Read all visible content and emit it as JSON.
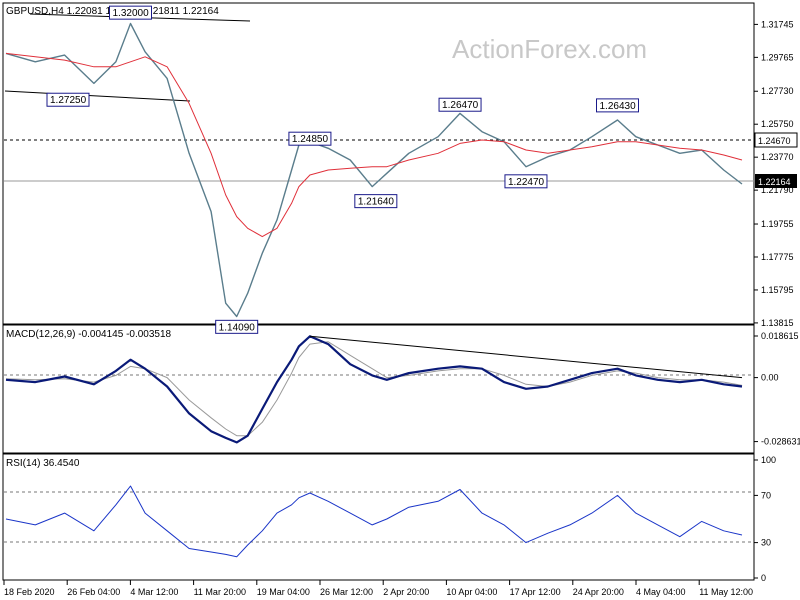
{
  "colors": {
    "price": "#5a7d8c",
    "ema": "#e0303a",
    "macd": "#0a1a78",
    "signal": "#9a9a9a",
    "rsi": "#1a35c8",
    "box_border": "#1a1a8a"
  },
  "watermark": "ActionForex.com",
  "price_panel": {
    "header": "GBPUSD,H4  1.22081 1.22178 1.21811 1.22164",
    "ylim": [
      1.1387,
      1.3285
    ],
    "ticks": [
      "1.31745",
      "1.29765",
      "1.27730",
      "1.25750",
      "1.23770",
      "1.21790",
      "1.19755",
      "1.17775",
      "1.15795",
      "1.13815"
    ],
    "current_price": "1.22164",
    "level_line": "1.24670",
    "annotations": [
      {
        "text": "1.32000",
        "x": 34,
        "y": 1.32
      },
      {
        "text": "1.27250",
        "x": 14,
        "y": 1.2725
      },
      {
        "text": "1.24850",
        "x": 83,
        "y": 1.2485
      },
      {
        "text": "1.21640",
        "x": 101,
        "y": 1.2164
      },
      {
        "text": "1.26470",
        "x": 124,
        "y": 1.2647
      },
      {
        "text": "1.22470",
        "x": 142,
        "y": 1.2247
      },
      {
        "text": "1.26430",
        "x": 167,
        "y": 1.2643
      },
      {
        "text": "1.14090",
        "x": 63,
        "y": 1.1409
      }
    ]
  },
  "macd_panel": {
    "header": "MACD(12,26,9) -0.004145 -0.003518",
    "ylim": [
      -0.0315,
      0.0213
    ],
    "ticks": [
      "0.018615",
      "0.00",
      "-0.028631"
    ]
  },
  "rsi_panel": {
    "header": "RSI(14) 36.4540",
    "ylim": [
      0,
      100
    ],
    "ticks": [
      "100",
      "70",
      "30",
      "0"
    ]
  },
  "time_axis": [
    "18 Feb 2020",
    "26 Feb 04:00",
    "4 Mar 12:00",
    "11 Mar 20:00",
    "19 Mar 04:00",
    "26 Mar 12:00",
    "2 Apr 20:00",
    "10 Apr 04:00",
    "17 Apr 12:00",
    "24 Apr 20:00",
    "4 May 04:00",
    "11 May 12:00"
  ],
  "chart_data": [
    {
      "type": "line",
      "title": "GBPUSD,H4  1.22081 1.22178 1.21811 1.22164",
      "x": [
        0,
        8,
        16,
        24,
        30,
        34,
        38,
        44,
        50,
        56,
        60,
        63,
        66,
        70,
        74,
        78,
        80,
        83,
        88,
        94,
        100,
        104,
        110,
        118,
        124,
        130,
        136,
        142,
        148,
        154,
        160,
        167,
        172,
        178,
        184,
        190,
        196,
        201
      ],
      "ylim": [
        1.1387,
        1.3285
      ],
      "series": [
        {
          "values": [
            1.3,
            1.295,
            1.299,
            1.282,
            1.295,
            1.318,
            1.301,
            1.285,
            1.24,
            1.205,
            1.15,
            1.142,
            1.156,
            1.18,
            1.2,
            1.23,
            1.245,
            1.247,
            1.243,
            1.236,
            1.22,
            1.228,
            1.24,
            1.25,
            1.264,
            1.253,
            1.247,
            1.232,
            1.238,
            1.242,
            1.25,
            1.26,
            1.25,
            1.245,
            1.24,
            1.242,
            1.23,
            1.2216
          ]
        },
        {
          "values": [
            1.3,
            1.298,
            1.296,
            1.292,
            1.292,
            1.295,
            1.298,
            1.292,
            1.27,
            1.24,
            1.215,
            1.202,
            1.195,
            1.19,
            1.195,
            1.21,
            1.22,
            1.227,
            1.23,
            1.231,
            1.232,
            1.232,
            1.236,
            1.24,
            1.246,
            1.248,
            1.247,
            1.242,
            1.24,
            1.242,
            1.244,
            1.247,
            1.247,
            1.245,
            1.243,
            1.242,
            1.239,
            1.236
          ]
        }
      ]
    },
    {
      "type": "line",
      "title": "MACD(12,26,9) -0.004145 -0.003518",
      "x": [
        0,
        8,
        16,
        24,
        30,
        34,
        38,
        44,
        50,
        56,
        60,
        63,
        66,
        70,
        74,
        78,
        80,
        83,
        88,
        94,
        100,
        104,
        110,
        118,
        124,
        130,
        136,
        142,
        148,
        154,
        160,
        167,
        172,
        178,
        184,
        190,
        196,
        201
      ],
      "ylim": [
        -0.0315,
        0.0213
      ],
      "series": [
        {
          "values": [
            -0.001,
            -0.002,
            0.0005,
            -0.003,
            0.003,
            0.008,
            0.004,
            -0.004,
            -0.016,
            -0.024,
            -0.027,
            -0.029,
            -0.026,
            -0.014,
            -0.002,
            0.008,
            0.014,
            0.0185,
            0.015,
            0.006,
            0.001,
            -0.001,
            0.002,
            0.004,
            0.005,
            0.004,
            -0.002,
            -0.005,
            -0.004,
            -0.001,
            0.002,
            0.004,
            0.001,
            -0.001,
            -0.002,
            -0.001,
            -0.003,
            -0.004
          ]
        },
        {
          "values": [
            -0.0005,
            -0.001,
            -0.0005,
            -0.002,
            0.001,
            0.005,
            0.004,
            0.0,
            -0.01,
            -0.018,
            -0.023,
            -0.026,
            -0.026,
            -0.02,
            -0.01,
            0.002,
            0.009,
            0.015,
            0.016,
            0.01,
            0.004,
            0.0,
            0.001,
            0.003,
            0.004,
            0.004,
            0.001,
            -0.003,
            -0.004,
            -0.002,
            0.001,
            0.003,
            0.002,
            0.0,
            -0.001,
            -0.001,
            -0.002,
            -0.0035
          ]
        },
        {
          "values": [
            0.0185,
            0.0
          ]
        }
      ]
    },
    {
      "type": "line",
      "title": "RSI(14) 36.4540",
      "x": [
        0,
        8,
        16,
        24,
        30,
        34,
        38,
        44,
        50,
        56,
        60,
        63,
        66,
        70,
        74,
        78,
        80,
        83,
        88,
        94,
        100,
        104,
        110,
        118,
        124,
        130,
        136,
        142,
        148,
        154,
        160,
        167,
        172,
        178,
        184,
        190,
        196,
        201
      ],
      "ylim": [
        0,
        100
      ],
      "series": [
        {
          "values": [
            50,
            45,
            55,
            40,
            62,
            78,
            55,
            40,
            25,
            22,
            20,
            18,
            28,
            40,
            55,
            62,
            68,
            72,
            65,
            55,
            45,
            50,
            60,
            65,
            75,
            55,
            45,
            30,
            38,
            45,
            55,
            70,
            55,
            45,
            35,
            48,
            40,
            36.454
          ]
        }
      ]
    }
  ]
}
